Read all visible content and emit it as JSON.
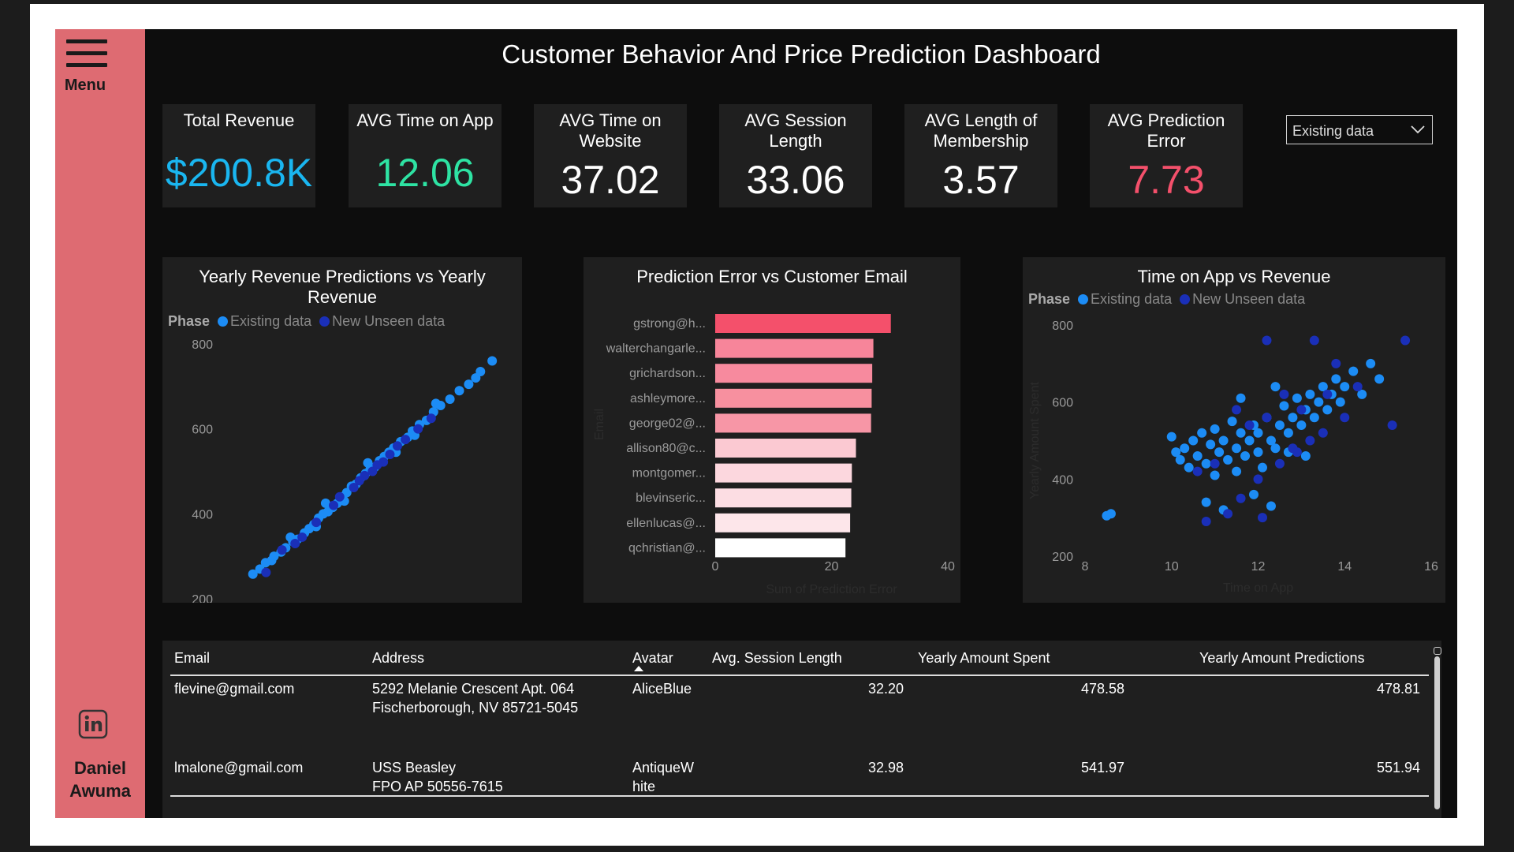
{
  "dashboard": {
    "title": "Customer Behavior And Price Prediction Dashboard"
  },
  "sidebar": {
    "menu_label": "Menu",
    "author_first": "Daniel",
    "author_last": "Awuma",
    "linkedin_icon": "linkedin-icon"
  },
  "kpis": [
    {
      "label": "Total Revenue",
      "value": "$200.8K",
      "color": "#1ab6f0"
    },
    {
      "label": "AVG Time on App",
      "value": "12.06",
      "color": "#2ee3a3"
    },
    {
      "label": "AVG Time on Website",
      "value": "37.02",
      "color": "#ffffff"
    },
    {
      "label": "AVG Session Length",
      "value": "33.06",
      "color": "#ffffff"
    },
    {
      "label": "AVG Length of Membership",
      "value": "3.57",
      "color": "#ffffff"
    },
    {
      "label": "AVG Prediction Error",
      "value": "7.73",
      "color": "#f4506b"
    }
  ],
  "filter": {
    "selected": "Existing data"
  },
  "legend": {
    "title": "Phase",
    "existing": "Existing data",
    "unseen": "New Unseen data",
    "existing_color": "#1c8cf5",
    "unseen_color": "#1a2fb8"
  },
  "chart_data": [
    {
      "type": "scatter",
      "title": "Yearly Revenue Predictions vs Yearly Revenue",
      "xlabel": "",
      "ylabel": "",
      "xlim": [
        200,
        800
      ],
      "ylim": [
        200,
        800
      ],
      "x_ticks": [
        "200",
        "400",
        "600",
        "800"
      ],
      "y_ticks": [
        "800",
        "600",
        "400",
        "200"
      ],
      "series": [
        {
          "name": "Existing data",
          "points": [
            [
              260,
              258
            ],
            [
              275,
              270
            ],
            [
              287,
              285
            ],
            [
              300,
              290
            ],
            [
              305,
              300
            ],
            [
              320,
              310
            ],
            [
              330,
              320
            ],
            [
              345,
              335
            ],
            [
              355,
              340
            ],
            [
              370,
              355
            ],
            [
              380,
              365
            ],
            [
              390,
              375
            ],
            [
              400,
              390
            ],
            [
              410,
              400
            ],
            [
              420,
              405
            ],
            [
              430,
              415
            ],
            [
              440,
              425
            ],
            [
              450,
              440
            ],
            [
              460,
              450
            ],
            [
              470,
              465
            ],
            [
              480,
              470
            ],
            [
              490,
              485
            ],
            [
              500,
              495
            ],
            [
              510,
              505
            ],
            [
              520,
              510
            ],
            [
              530,
              525
            ],
            [
              540,
              535
            ],
            [
              550,
              545
            ],
            [
              560,
              555
            ],
            [
              575,
              570
            ],
            [
              590,
              580
            ],
            [
              600,
              595
            ],
            [
              615,
              610
            ],
            [
              630,
              620
            ],
            [
              645,
              640
            ],
            [
              660,
              655
            ],
            [
              680,
              670
            ],
            [
              700,
              690
            ],
            [
              720,
              705
            ],
            [
              735,
              720
            ],
            [
              745,
              735
            ],
            [
              770,
              760
            ],
            [
              340,
              345
            ],
            [
              395,
              370
            ],
            [
              415,
              425
            ],
            [
              455,
              430
            ],
            [
              505,
              520
            ],
            [
              565,
              545
            ],
            [
              605,
              585
            ],
            [
              650,
              660
            ]
          ]
        },
        {
          "name": "New Unseen data",
          "points": [
            [
              288,
              262
            ],
            [
              350,
              330
            ],
            [
              395,
              380
            ],
            [
              432,
              420
            ],
            [
              475,
              462
            ],
            [
              498,
              490
            ],
            [
              515,
              500
            ],
            [
              538,
              522
            ],
            [
              552,
              540
            ],
            [
              568,
              560
            ],
            [
              585,
              575
            ],
            [
              612,
              600
            ],
            [
              640,
              625
            ],
            [
              322,
              315
            ],
            [
              365,
              345
            ],
            [
              445,
              440
            ],
            [
              487,
              478
            ],
            [
              525,
              515
            ]
          ]
        }
      ]
    },
    {
      "type": "bar",
      "title": "Prediction Error vs Customer Email",
      "xlabel": "Sum of Prediction Error",
      "ylabel": "Email",
      "xlim": [
        0,
        40
      ],
      "x_ticks": [
        "0",
        "20",
        "40"
      ],
      "categories": [
        "gstrong@h...",
        "walterchangarle...",
        "grichardson...",
        "ashleymore...",
        "george02@...",
        "allison80@c...",
        "montgomer...",
        "blevinseric...",
        "ellenlucas@...",
        "qchristian@..."
      ],
      "display_categories": [
        "gstrong@h...",
        "walterchangarle...",
        "grichardson...",
        "ashleymore...",
        "george02@...",
        "allison80@c...",
        "montgomer...",
        "blevinseric...",
        "ellenlucas@...",
        "qchristian@..."
      ],
      "values": [
        30.2,
        27.2,
        27.0,
        26.9,
        26.8,
        24.2,
        23.5,
        23.4,
        23.2,
        22.4
      ],
      "colors": [
        "#f4506b",
        "#f7859a",
        "#f78a9e",
        "#f7909f",
        "#f796a6",
        "#fbc9d2",
        "#fcd7de",
        "#fcdde3",
        "#fde6ea",
        "#ffffff"
      ]
    },
    {
      "type": "scatter",
      "title": "Time on App vs Revenue",
      "xlabel": "Time on App",
      "ylabel": "Yearly Amount Spent",
      "xlim": [
        8,
        16
      ],
      "ylim": [
        200,
        800
      ],
      "x_ticks": [
        "8",
        "10",
        "12",
        "14",
        "16"
      ],
      "y_ticks": [
        "800",
        "600",
        "400",
        "200"
      ],
      "series": [
        {
          "name": "Existing data",
          "points": [
            [
              8.5,
              305
            ],
            [
              8.6,
              310
            ],
            [
              10.0,
              510
            ],
            [
              10.1,
              470
            ],
            [
              10.2,
              450
            ],
            [
              10.3,
              480
            ],
            [
              10.4,
              430
            ],
            [
              10.5,
              500
            ],
            [
              10.6,
              460
            ],
            [
              10.7,
              520
            ],
            [
              10.8,
              440
            ],
            [
              10.9,
              490
            ],
            [
              11.0,
              530
            ],
            [
              11.0,
              410
            ],
            [
              11.1,
              470
            ],
            [
              11.2,
              500
            ],
            [
              11.3,
              450
            ],
            [
              11.4,
              550
            ],
            [
              11.5,
              480
            ],
            [
              11.5,
              420
            ],
            [
              11.6,
              520
            ],
            [
              11.7,
              460
            ],
            [
              11.8,
              500
            ],
            [
              11.9,
              540
            ],
            [
              12.0,
              470
            ],
            [
              12.0,
              520
            ],
            [
              12.1,
              430
            ],
            [
              12.2,
              560
            ],
            [
              12.3,
              500
            ],
            [
              12.4,
              480
            ],
            [
              12.5,
              540
            ],
            [
              12.6,
              590
            ],
            [
              12.7,
              520
            ],
            [
              12.8,
              560
            ],
            [
              12.9,
              610
            ],
            [
              13.0,
              540
            ],
            [
              13.1,
              580
            ],
            [
              13.2,
              620
            ],
            [
              13.3,
              560
            ],
            [
              13.4,
              600
            ],
            [
              13.5,
              640
            ],
            [
              13.6,
              580
            ],
            [
              13.7,
              620
            ],
            [
              13.8,
              660
            ],
            [
              13.9,
              600
            ],
            [
              14.0,
              640
            ],
            [
              14.2,
              680
            ],
            [
              14.4,
              620
            ],
            [
              14.6,
              700
            ],
            [
              14.8,
              660
            ],
            [
              11.9,
              360
            ],
            [
              12.3,
              330
            ],
            [
              11.2,
              320
            ],
            [
              10.8,
              340
            ],
            [
              12.7,
              470
            ],
            [
              13.1,
              460
            ],
            [
              11.6,
              610
            ],
            [
              12.4,
              640
            ]
          ]
        },
        {
          "name": "New Unseen data",
          "points": [
            [
              10.8,
              290
            ],
            [
              11.3,
              310
            ],
            [
              11.6,
              350
            ],
            [
              12.1,
              300
            ],
            [
              12.0,
              400
            ],
            [
              12.5,
              440
            ],
            [
              12.8,
              480
            ],
            [
              13.2,
              500
            ],
            [
              13.5,
              520
            ],
            [
              12.2,
              560
            ],
            [
              11.8,
              540
            ],
            [
              13.0,
              580
            ],
            [
              13.6,
              620
            ],
            [
              14.0,
              560
            ],
            [
              12.6,
              620
            ],
            [
              11.5,
              580
            ],
            [
              10.6,
              420
            ],
            [
              13.8,
              700
            ],
            [
              12.2,
              760
            ],
            [
              14.3,
              640
            ],
            [
              15.1,
              540
            ],
            [
              15.4,
              760
            ],
            [
              13.3,
              760
            ],
            [
              12.9,
              470
            ],
            [
              11.0,
              440
            ]
          ]
        }
      ]
    }
  ],
  "table": {
    "columns": [
      "Email",
      "Address",
      "Avatar",
      "Avg. Session Length",
      "Yearly Amount Spent",
      "Yearly Amount Predictions"
    ],
    "rows": [
      {
        "email": "flevine@gmail.com",
        "address1": "5292 Melanie Crescent Apt. 064",
        "address2": "Fischerborough, NV 85721-5045",
        "avatar1": "AliceBlue",
        "avatar2": "",
        "session": "32.20",
        "spent": "478.58",
        "pred": "478.81"
      },
      {
        "email": "",
        "address1": "",
        "address2": "",
        "avatar1": "",
        "avatar2": "",
        "session": "",
        "spent": "",
        "pred": ""
      },
      {
        "email": "lmalone@gmail.com",
        "address1": "USS Beasley",
        "address2": "FPO AP 50556-7615",
        "avatar1": "AntiqueW",
        "avatar2": "hite",
        "session": "32.98",
        "spent": "541.97",
        "pred": "551.94"
      }
    ],
    "total": {
      "label": "",
      "session": "",
      "spent": "",
      "pred": ""
    }
  }
}
